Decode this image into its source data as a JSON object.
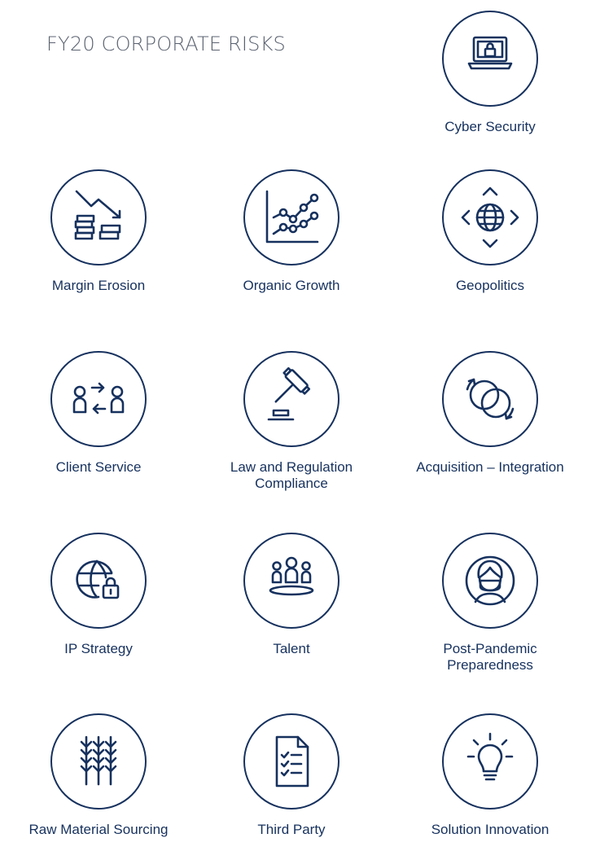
{
  "page": {
    "title": "FY20 CORPORATE RISKS"
  },
  "colors": {
    "navy": "#16315e",
    "title_gray": "#5a6270",
    "background": "#ffffff"
  },
  "risks": [
    {
      "icon": "laptop-lock-icon",
      "label": [
        "Cyber Security"
      ]
    },
    {
      "icon": "declining-coins-icon",
      "label": [
        "Margin Erosion"
      ]
    },
    {
      "icon": "growth-chart-icon",
      "label": [
        "Organic Growth"
      ]
    },
    {
      "icon": "globe-arrows-icon",
      "label": [
        "Geopolitics"
      ]
    },
    {
      "icon": "people-exchange-icon",
      "label": [
        "Client Service"
      ]
    },
    {
      "icon": "gavel-icon",
      "label": [
        "Law and Regulation",
        "Compliance"
      ]
    },
    {
      "icon": "merging-circles-icon",
      "label": [
        "Acquisition – Integration"
      ]
    },
    {
      "icon": "globe-lock-icon",
      "label": [
        "IP Strategy"
      ]
    },
    {
      "icon": "team-icon",
      "label": [
        "Talent"
      ]
    },
    {
      "icon": "masked-person-icon",
      "label": [
        "Post-Pandemic",
        "Preparedness"
      ]
    },
    {
      "icon": "wheat-icon",
      "label": [
        "Raw Material Sourcing"
      ]
    },
    {
      "icon": "checklist-document-icon",
      "label": [
        "Third Party"
      ]
    },
    {
      "icon": "lightbulb-icon",
      "label": [
        "Solution Innovation"
      ]
    }
  ]
}
